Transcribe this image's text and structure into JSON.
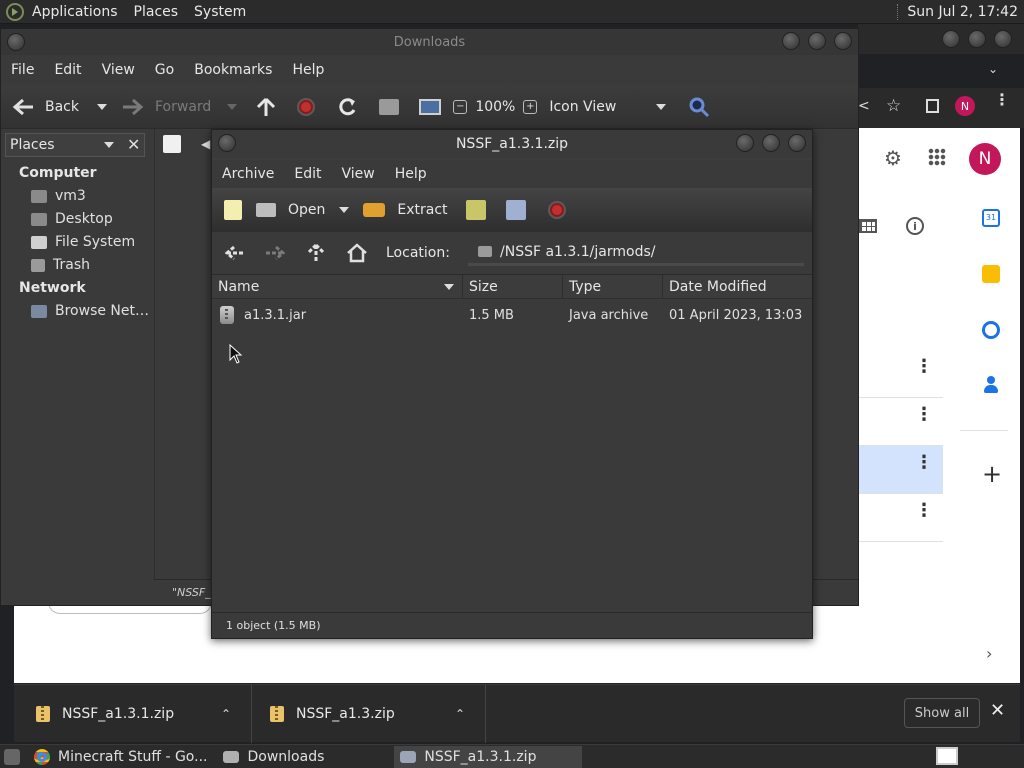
{
  "top_panel": {
    "menus": [
      "Applications",
      "Places",
      "System"
    ],
    "clock": "Sun Jul  2, 17:42"
  },
  "file_manager": {
    "title": "Downloads",
    "menus": [
      "File",
      "Edit",
      "View",
      "Go",
      "Bookmarks",
      "Help"
    ],
    "toolbar": {
      "back": "Back",
      "forward": "Forward",
      "zoom": "100%",
      "view_mode": "Icon View"
    },
    "sidebar": {
      "header": "Places",
      "sections": [
        {
          "title": "Computer",
          "items": [
            "vm3",
            "Desktop",
            "File System",
            "Trash"
          ]
        },
        {
          "title": "Network",
          "items": [
            "Browse Net…"
          ]
        }
      ]
    },
    "status": "\"NSSF_a"
  },
  "archive_manager": {
    "title": "NSSF_a1.3.1.zip",
    "menus": [
      "Archive",
      "Edit",
      "View",
      "Help"
    ],
    "toolbar": {
      "open": "Open",
      "extract": "Extract"
    },
    "location_label": "Location:",
    "location_path": "/NSSF a1.3.1/jarmods/",
    "columns": [
      "Name",
      "Size",
      "Type",
      "Date Modified"
    ],
    "rows": [
      {
        "name": "a1.3.1.jar",
        "size": "1.5 MB",
        "type": "Java archive",
        "date": "01 April 2023, 13:03"
      }
    ],
    "status": "1 object (1.5 MB)"
  },
  "chrome": {
    "avatar_letter": "N",
    "downloads": [
      {
        "name": "NSSF_a1.3.1.zip"
      },
      {
        "name": "NSSF_a1.3.zip"
      }
    ],
    "show_all": "Show all"
  },
  "taskbar": {
    "tasks": [
      "Minecraft Stuff - Go...",
      "Downloads",
      "NSSF_a1.3.1.zip"
    ]
  }
}
